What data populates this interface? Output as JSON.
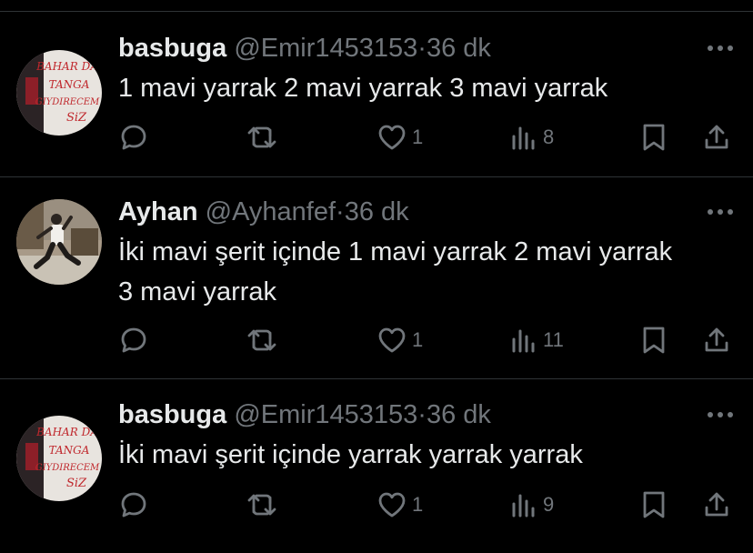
{
  "feed": {
    "tweets": [
      {
        "avatar_text": [
          "BAHAR DA",
          "TANGA",
          "GIYDIRECEM",
          "SiZ"
        ],
        "name": "basbuga",
        "handle": "@Emir1453153",
        "separator": "·",
        "time": "36 dk",
        "text": "1 mavi yarrak 2 mavi yarrak 3 mavi yarrak",
        "likes": "1",
        "views": "8",
        "icons": [
          "reply-icon",
          "retweet-icon",
          "like-icon",
          "views-icon",
          "bookmark-icon",
          "share-icon",
          "more-icon"
        ]
      },
      {
        "name": "Ayhan",
        "handle": "@Ayhanfef",
        "separator": "·",
        "time": "36 dk",
        "text": "İki mavi şerit içinde 1 mavi yarrak 2 mavi yarrak\n3 mavi yarrak",
        "likes": "1",
        "views": "11",
        "icons": [
          "reply-icon",
          "retweet-icon",
          "like-icon",
          "views-icon",
          "bookmark-icon",
          "share-icon",
          "more-icon"
        ]
      },
      {
        "avatar_text": [
          "BAHAR DA",
          "TANGA",
          "GIYDIRECEM",
          "SiZ"
        ],
        "name": "basbuga",
        "handle": "@Emir1453153",
        "separator": "·",
        "time": "36 dk",
        "text": "İki mavi şerit içinde yarrak yarrak yarrak",
        "likes": "1",
        "views": "9",
        "icons": [
          "reply-icon",
          "retweet-icon",
          "like-icon",
          "views-icon",
          "bookmark-icon",
          "share-icon",
          "more-icon"
        ]
      }
    ]
  },
  "colors": {
    "background": "#000000",
    "primary_text": "#e7e9ea",
    "secondary_text": "#71767b",
    "divider": "#2f3336",
    "graffiti_red": "#c0282d"
  }
}
